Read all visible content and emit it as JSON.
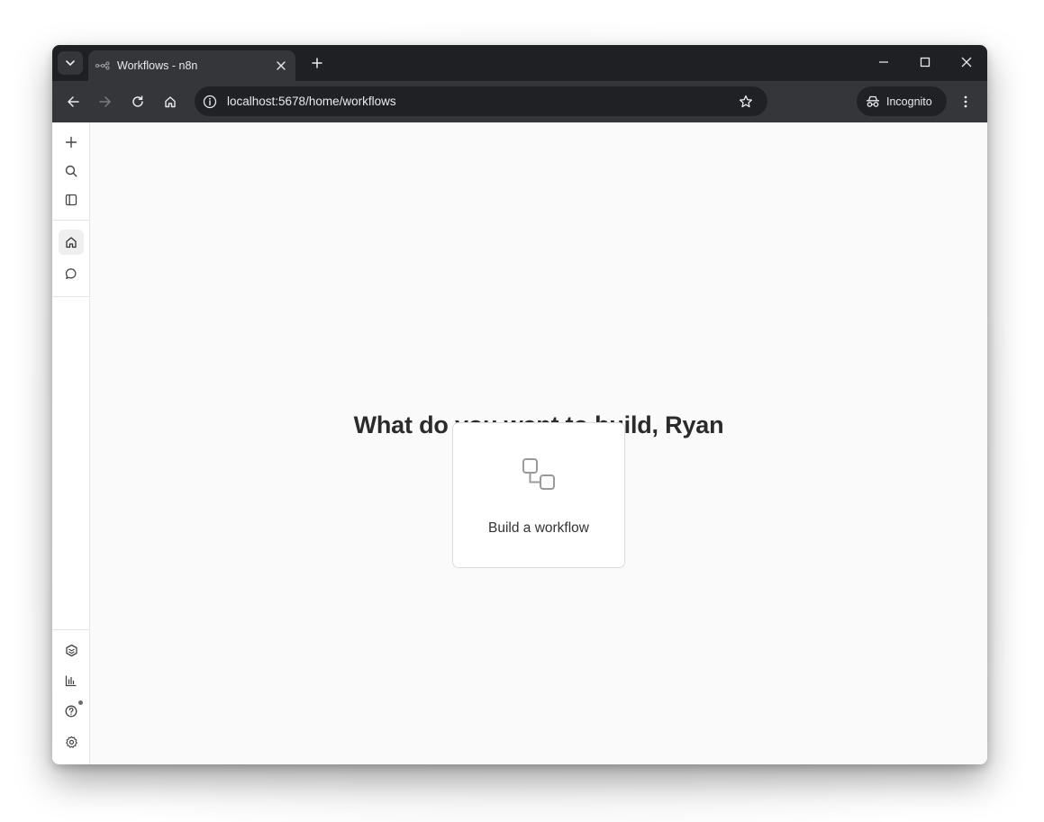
{
  "browser": {
    "tab": {
      "title": "Workflows - n8n",
      "favicon": "n8n-icon"
    },
    "new_tab_icon": "plus-icon",
    "window_controls": [
      "minimize-icon",
      "maximize-icon",
      "close-icon"
    ],
    "toolbar": {
      "back_icon": "arrow-left-icon",
      "forward_icon": "arrow-right-icon",
      "reload_icon": "reload-icon",
      "home_icon": "home-icon",
      "url": "localhost:5678/home/workflows",
      "bookmark_icon": "star-icon",
      "profile_label": "Incognito",
      "menu_icon": "three-dots-icon"
    }
  },
  "sidebar": {
    "top_items": [
      "plus-icon",
      "search-icon",
      "panel-toggle-icon"
    ],
    "nav_items": [
      {
        "icon": "home-icon",
        "active": true
      },
      {
        "icon": "chat-icon",
        "active": false
      }
    ],
    "bottom_items": [
      "templates-icon",
      "insights-icon",
      "help-icon",
      "settings-icon"
    ]
  },
  "main": {
    "heading": "What do you want to build, Ryan",
    "card": {
      "label": "Build a workflow",
      "icon": "workflow-nodes-icon"
    }
  },
  "colors": {
    "tabstrip_bg": "#1f2023",
    "toolbar_bg": "#35363a",
    "omnibox_bg": "#202124",
    "app_bg": "#fafafa",
    "heading_text": "#2b2b2b"
  }
}
